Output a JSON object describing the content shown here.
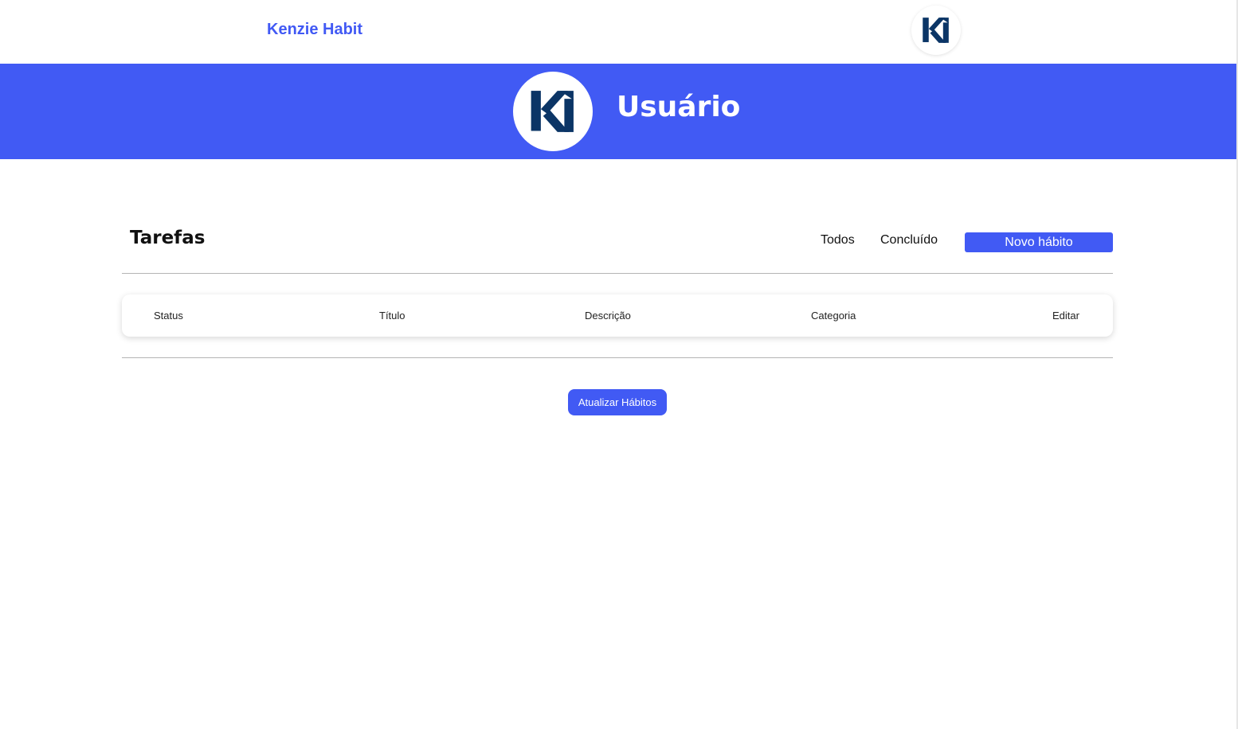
{
  "header": {
    "brand": "Kenzie Habit",
    "avatar_icon": "kh-logo-icon"
  },
  "banner": {
    "avatar_icon": "kh-logo-icon",
    "user_name": "Usuário"
  },
  "tasks": {
    "title": "Tarefas",
    "filters": [
      "Todos",
      "Concluído"
    ],
    "new_habit_label": "Novo hábito",
    "columns": [
      "Status",
      "Título",
      "Descrição",
      "Categoria",
      "Editar"
    ],
    "rows": [],
    "refresh_label": "Atualizar Hábitos"
  },
  "colors": {
    "accent": "#415af4",
    "logo": "#0b3566",
    "background": "#ffffff"
  }
}
